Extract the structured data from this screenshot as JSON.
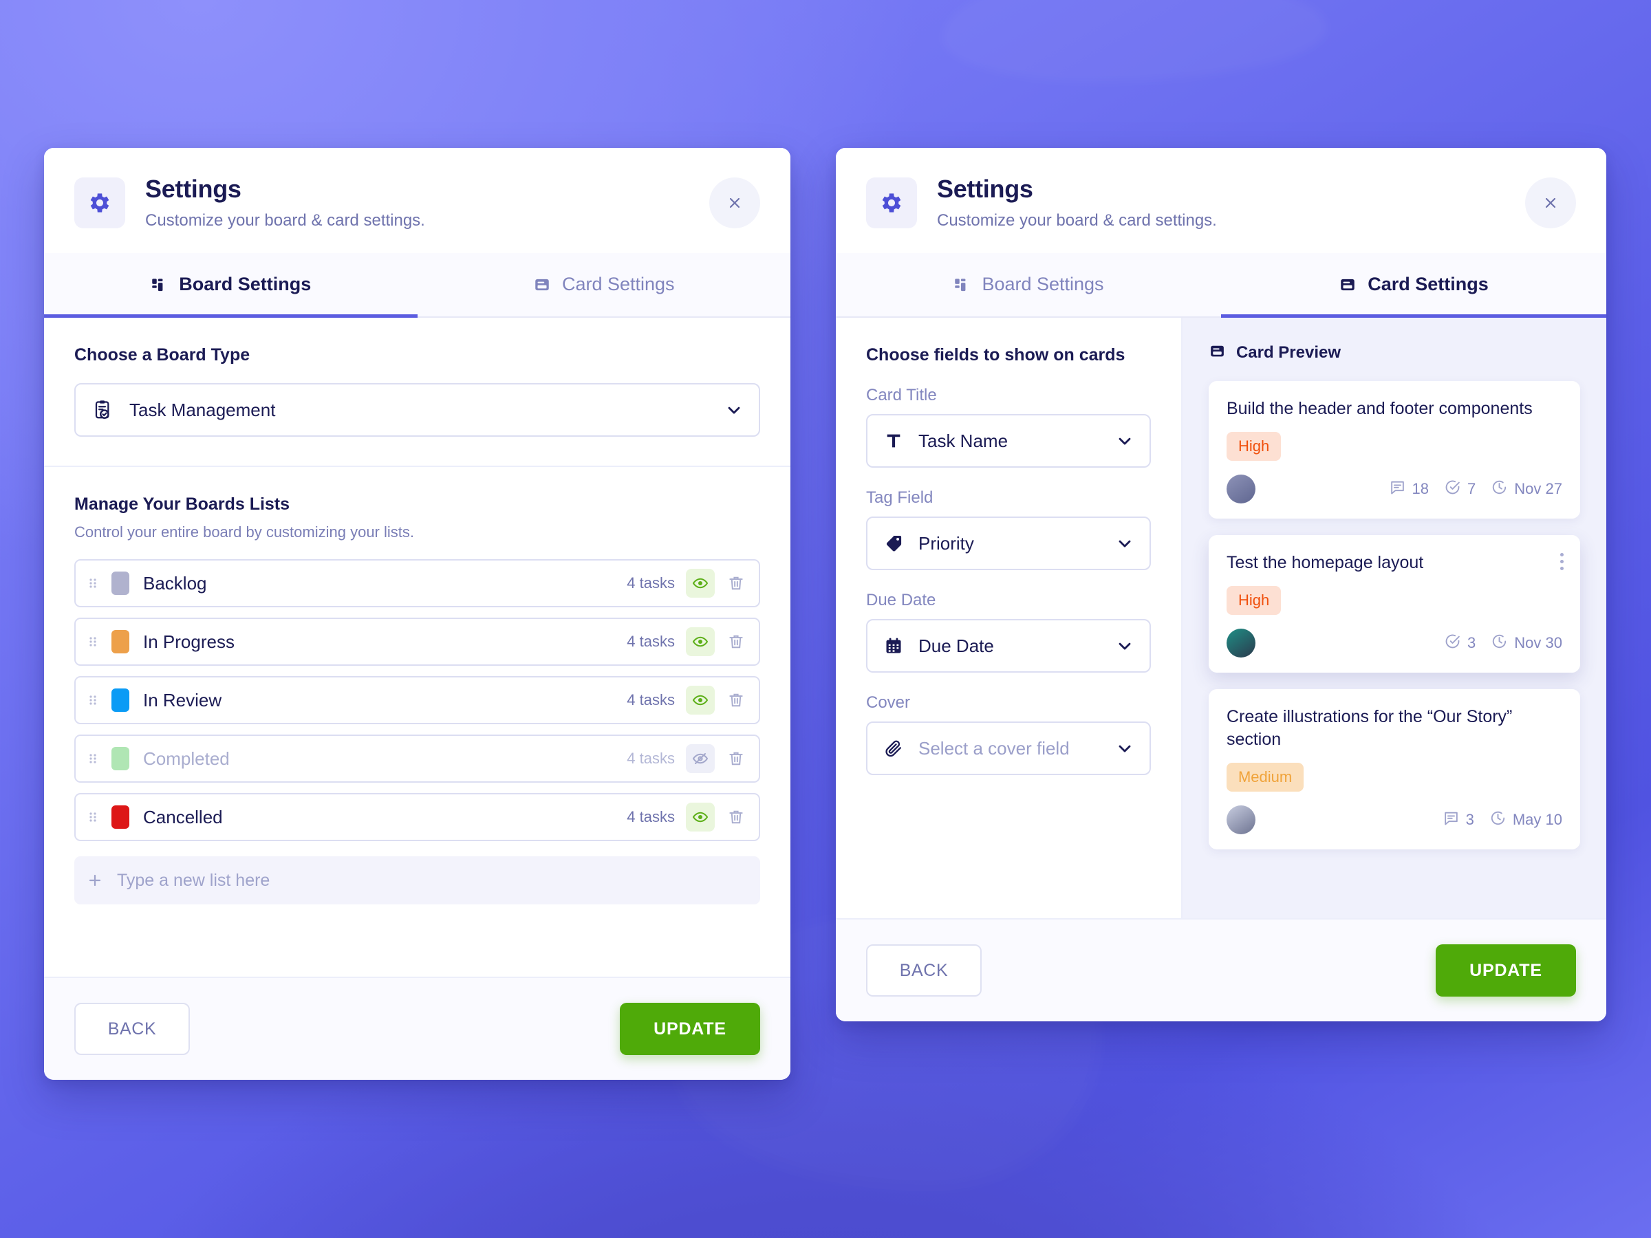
{
  "background": {
    "accent": "#5b5ce0",
    "deep": "#4a4acb",
    "light": "#8285f7"
  },
  "panels": {
    "left": {
      "header": {
        "title": "Settings",
        "subtitle": "Customize your board & card settings.",
        "icon": "gear-icon",
        "close_label": "×"
      },
      "tabs": [
        {
          "label": "Board Settings",
          "icon": "board-icon",
          "active": true
        },
        {
          "label": "Card Settings",
          "icon": "card-icon",
          "active": false
        }
      ],
      "board_type": {
        "section_title": "Choose a Board Type",
        "selected": "Task Management",
        "icon": "clipboard-check-icon"
      },
      "lists_section": {
        "title": "Manage Your Boards Lists",
        "subtitle": "Control your entire board by customizing your lists.",
        "rows": [
          {
            "name": "Backlog",
            "count": "4 tasks",
            "color": "#b0b2ce",
            "visible": true
          },
          {
            "name": "In Progress",
            "count": "4 tasks",
            "color": "#eda04a",
            "visible": true
          },
          {
            "name": "In Review",
            "count": "4 tasks",
            "color": "#0b9bf5",
            "visible": true
          },
          {
            "name": "Completed",
            "count": "4 tasks",
            "color": "#b0e6b4",
            "visible": false
          },
          {
            "name": "Cancelled",
            "count": "4 tasks",
            "color": "#dd1717",
            "visible": true
          }
        ],
        "new_list_placeholder": "Type a new list here"
      },
      "footer": {
        "back": "BACK",
        "update": "UPDATE",
        "update_color": "#4faa09"
      }
    },
    "right": {
      "header": {
        "title": "Settings",
        "subtitle": "Customize your board & card settings.",
        "icon": "gear-icon",
        "close_label": "×"
      },
      "tabs": [
        {
          "label": "Board Settings",
          "icon": "board-icon",
          "active": false
        },
        {
          "label": "Card Settings",
          "icon": "card-icon",
          "active": true
        }
      ],
      "fields_section": {
        "title": "Choose fields to show on cards",
        "fields": [
          {
            "label": "Card Title",
            "value": "Task Name",
            "icon": "text-t-icon",
            "placeholder": false
          },
          {
            "label": "Tag Field",
            "value": "Priority",
            "icon": "tag-icon",
            "placeholder": false
          },
          {
            "label": "Due Date",
            "value": "Due Date",
            "icon": "calendar-icon",
            "placeholder": false
          },
          {
            "label": "Cover",
            "value": "Select a cover field",
            "icon": "paperclip-icon",
            "placeholder": true
          }
        ]
      },
      "preview": {
        "label": "Card Preview",
        "icon": "card-icon",
        "cards": [
          {
            "title": "Build the header and footer components",
            "badge": "High",
            "badge_kind": "high",
            "avatar_colors": [
              "#8e93b8",
              "#5f6690"
            ],
            "show_menu": false,
            "meta": [
              {
                "icon": "comment-icon",
                "value": "18"
              },
              {
                "icon": "checkbox-icon",
                "value": "7"
              },
              {
                "icon": "clock-icon",
                "value": "Nov 27"
              }
            ]
          },
          {
            "title": "Test the homepage layout",
            "badge": "High",
            "badge_kind": "high",
            "avatar_colors": [
              "#1f8f86",
              "#2b3a4d"
            ],
            "show_menu": true,
            "meta": [
              {
                "icon": "checkbox-icon",
                "value": "3"
              },
              {
                "icon": "clock-icon",
                "value": "Nov 30"
              }
            ]
          },
          {
            "title": "Create illustrations for the “Our Story” section",
            "badge": "Medium",
            "badge_kind": "medium",
            "avatar_colors": [
              "#c8cde0",
              "#6d7391"
            ],
            "show_menu": false,
            "meta": [
              {
                "icon": "comment-icon",
                "value": "3"
              },
              {
                "icon": "clock-icon",
                "value": "May 10"
              }
            ]
          }
        ]
      },
      "footer": {
        "back": "BACK",
        "update": "UPDATE",
        "update_color": "#4faa09"
      }
    }
  }
}
